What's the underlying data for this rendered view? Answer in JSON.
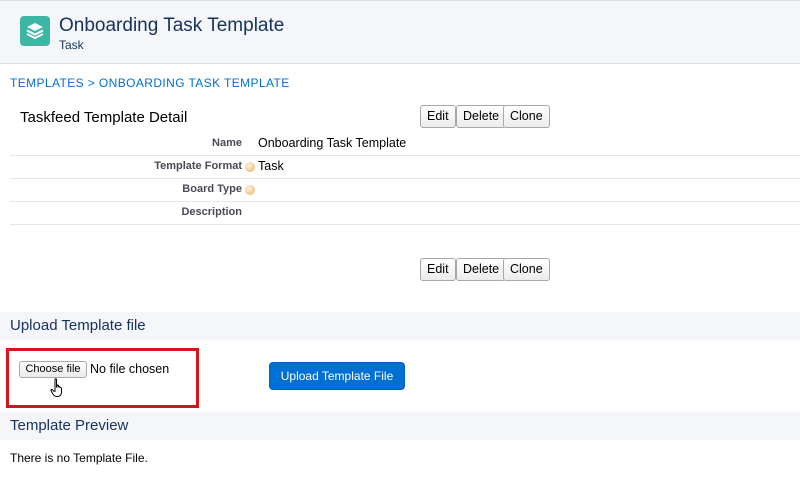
{
  "header": {
    "title": "Onboarding Task Template",
    "subtitle": "Task",
    "icon": "stacked-layers-icon",
    "icon_color": "#3fb5a5"
  },
  "breadcrumb": "TEMPLATES > ONBOARDING TASK TEMPLATE",
  "detail": {
    "title": "Taskfeed Template Detail",
    "buttons": {
      "edit": "Edit",
      "delete": "Delete",
      "clone": "Clone"
    },
    "fields": [
      {
        "label": "Name",
        "value": "Onboarding Task Template",
        "help": false
      },
      {
        "label": "Template Format",
        "value": "Task",
        "help": true
      },
      {
        "label": "Board Type",
        "value": "",
        "help": true
      },
      {
        "label": "Description",
        "value": "",
        "help": false
      }
    ]
  },
  "upload": {
    "section_title": "Upload Template file",
    "choose_file_label": "Choose file",
    "file_status": "No file chosen",
    "upload_button": "Upload Template File",
    "accent_color": "#0070d2",
    "highlight_color": "#d5141e"
  },
  "preview": {
    "section_title": "Template Preview",
    "empty_text": "There is no Template File."
  }
}
